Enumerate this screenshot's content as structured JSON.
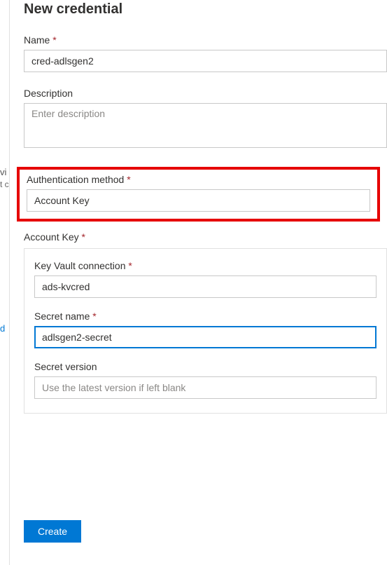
{
  "left_peek": {
    "t1": "vi",
    "t2": "t c",
    "t3": "d"
  },
  "title": "New credential",
  "name": {
    "label": "Name",
    "value": "cred-adlsgen2"
  },
  "description": {
    "label": "Description",
    "placeholder": "Enter description",
    "value": ""
  },
  "auth_method": {
    "label": "Authentication method",
    "value": "Account Key"
  },
  "account_key_section": {
    "label": "Account Key",
    "kv_connection": {
      "label": "Key Vault connection",
      "value": "ads-kvcred"
    },
    "secret_name": {
      "label": "Secret name",
      "value": "adlsgen2-secret"
    },
    "secret_version": {
      "label": "Secret version",
      "placeholder": "Use the latest version if left blank",
      "value": ""
    }
  },
  "buttons": {
    "create": "Create"
  }
}
